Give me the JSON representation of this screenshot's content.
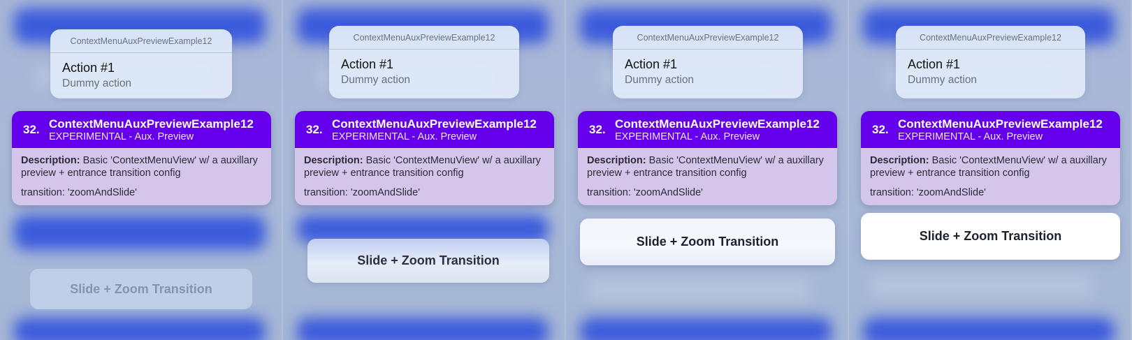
{
  "frames": [
    {
      "aux_title": "ContextMenuAuxPreviewExample12",
      "action_title": "Action #1",
      "action_subtitle": "Dummy action",
      "card": {
        "number": "32.",
        "title": "ContextMenuAuxPreviewExample12",
        "subtitle": "EXPERIMENTAL - Aux. Preview",
        "description_label": "Description:",
        "description_text": "Basic 'ContextMenuView' w/ a auxillary preview + entrance transition config",
        "transition": "transition: 'zoomAndSlide'"
      },
      "button_label": "Slide + Zoom Transition"
    },
    {
      "aux_title": "ContextMenuAuxPreviewExample12",
      "action_title": "Action #1",
      "action_subtitle": "Dummy action",
      "card": {
        "number": "32.",
        "title": "ContextMenuAuxPreviewExample12",
        "subtitle": "EXPERIMENTAL - Aux. Preview",
        "description_label": "Description:",
        "description_text": "Basic 'ContextMenuView' w/ a auxillary preview + entrance transition config",
        "transition": "transition: 'zoomAndSlide'"
      },
      "button_label": "Slide + Zoom Transition"
    },
    {
      "aux_title": "ContextMenuAuxPreviewExample12",
      "action_title": "Action #1",
      "action_subtitle": "Dummy action",
      "card": {
        "number": "32.",
        "title": "ContextMenuAuxPreviewExample12",
        "subtitle": "EXPERIMENTAL - Aux. Preview",
        "description_label": "Description:",
        "description_text": "Basic 'ContextMenuView' w/ a auxillary preview + entrance transition config",
        "transition": "transition: 'zoomAndSlide'"
      },
      "button_label": "Slide + Zoom Transition"
    },
    {
      "aux_title": "ContextMenuAuxPreviewExample12",
      "action_title": "Action #1",
      "action_subtitle": "Dummy action",
      "card": {
        "number": "32.",
        "title": "ContextMenuAuxPreviewExample12",
        "subtitle": "EXPERIMENTAL - Aux. Preview",
        "description_label": "Description:",
        "description_text": "Basic 'ContextMenuView' w/ a auxillary preview + entrance transition config",
        "transition": "transition: 'zoomAndSlide'"
      },
      "button_label": "Slide + Zoom Transition"
    }
  ],
  "colors": {
    "card_header": "#6500ec",
    "card_body": "#d4c5ea",
    "background_blue": "#3c5bdc",
    "background": "#a6b5d6"
  }
}
